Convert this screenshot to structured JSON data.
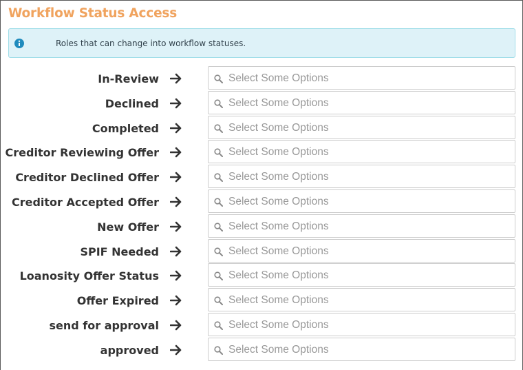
{
  "header": {
    "title": "Workflow Status Access"
  },
  "info": {
    "text": "Roles that can change into workflow statuses."
  },
  "select_placeholder": "Select Some Options",
  "statuses": [
    {
      "label": "In-Review"
    },
    {
      "label": "Declined"
    },
    {
      "label": "Completed"
    },
    {
      "label": "Creditor Reviewing Offer"
    },
    {
      "label": "Creditor Declined Offer"
    },
    {
      "label": "Creditor Accepted Offer"
    },
    {
      "label": "New Offer"
    },
    {
      "label": "SPIF Needed"
    },
    {
      "label": "Loanosity Offer Status"
    },
    {
      "label": "Offer Expired"
    },
    {
      "label": "send for approval"
    },
    {
      "label": "approved"
    }
  ],
  "colors": {
    "title": "#f0a35e",
    "info_bg": "#def2f8",
    "info_border": "#9fdde8",
    "info_icon": "#1f8bbd",
    "label": "#333333",
    "placeholder": "#999999"
  },
  "icons": {
    "info": "info-circle-icon",
    "arrow": "arrow-right-icon",
    "search": "search-icon"
  }
}
